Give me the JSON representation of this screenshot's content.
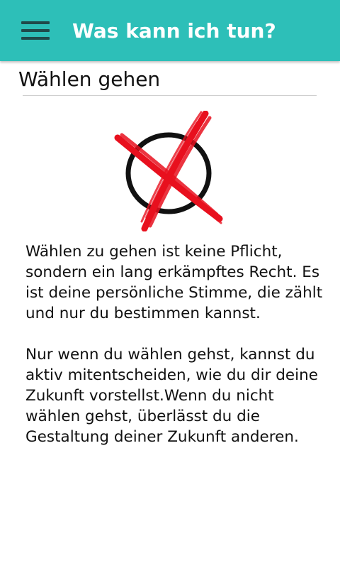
{
  "app_bar": {
    "title": "Was kann ich tun?",
    "menu_icon": "hamburger-menu-icon",
    "background_color": "#2dbfb8"
  },
  "page": {
    "section_title": "Wählen gehen",
    "illustration_icon": "ballot-cross-icon",
    "paragraphs": [
      "Wählen zu gehen ist keine Pflicht, sondern ein lang erkämpftes Recht. Es ist deine persönliche Stimme, die zählt und nur du bestimmen kannst.",
      "Nur wenn du wählen gehst, kannst du aktiv mitentscheiden, wie du dir deine Zukunft vorstellst.Wenn du nicht wählen gehst, überlässt du die Gestaltung deiner Zukunft anderen."
    ]
  }
}
